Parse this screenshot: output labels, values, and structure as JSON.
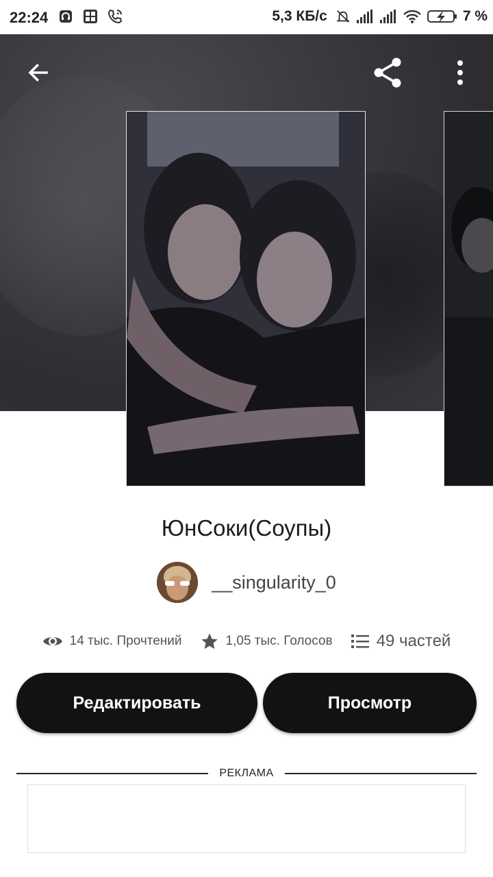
{
  "status_bar": {
    "time": "22:24",
    "network_speed": "5,3 КБ/с",
    "battery": "7 %"
  },
  "header": {
    "back_icon": "arrow-left-icon",
    "share_icon": "share-icon",
    "more_icon": "more-vertical-icon"
  },
  "story": {
    "title": "ЮнСоки(Соупы)",
    "author": "__singularity_0",
    "stats": {
      "reads": "14 тыс. Прочтений",
      "votes": "1,05 тыс. Голосов",
      "parts": "49 частей"
    }
  },
  "actions": {
    "edit_label": "Редактировать",
    "view_label": "Просмотр"
  },
  "ad": {
    "label": "РЕКЛАМА"
  },
  "colors": {
    "button_bg": "#121212",
    "hero_bg": "#3b3b3f"
  }
}
